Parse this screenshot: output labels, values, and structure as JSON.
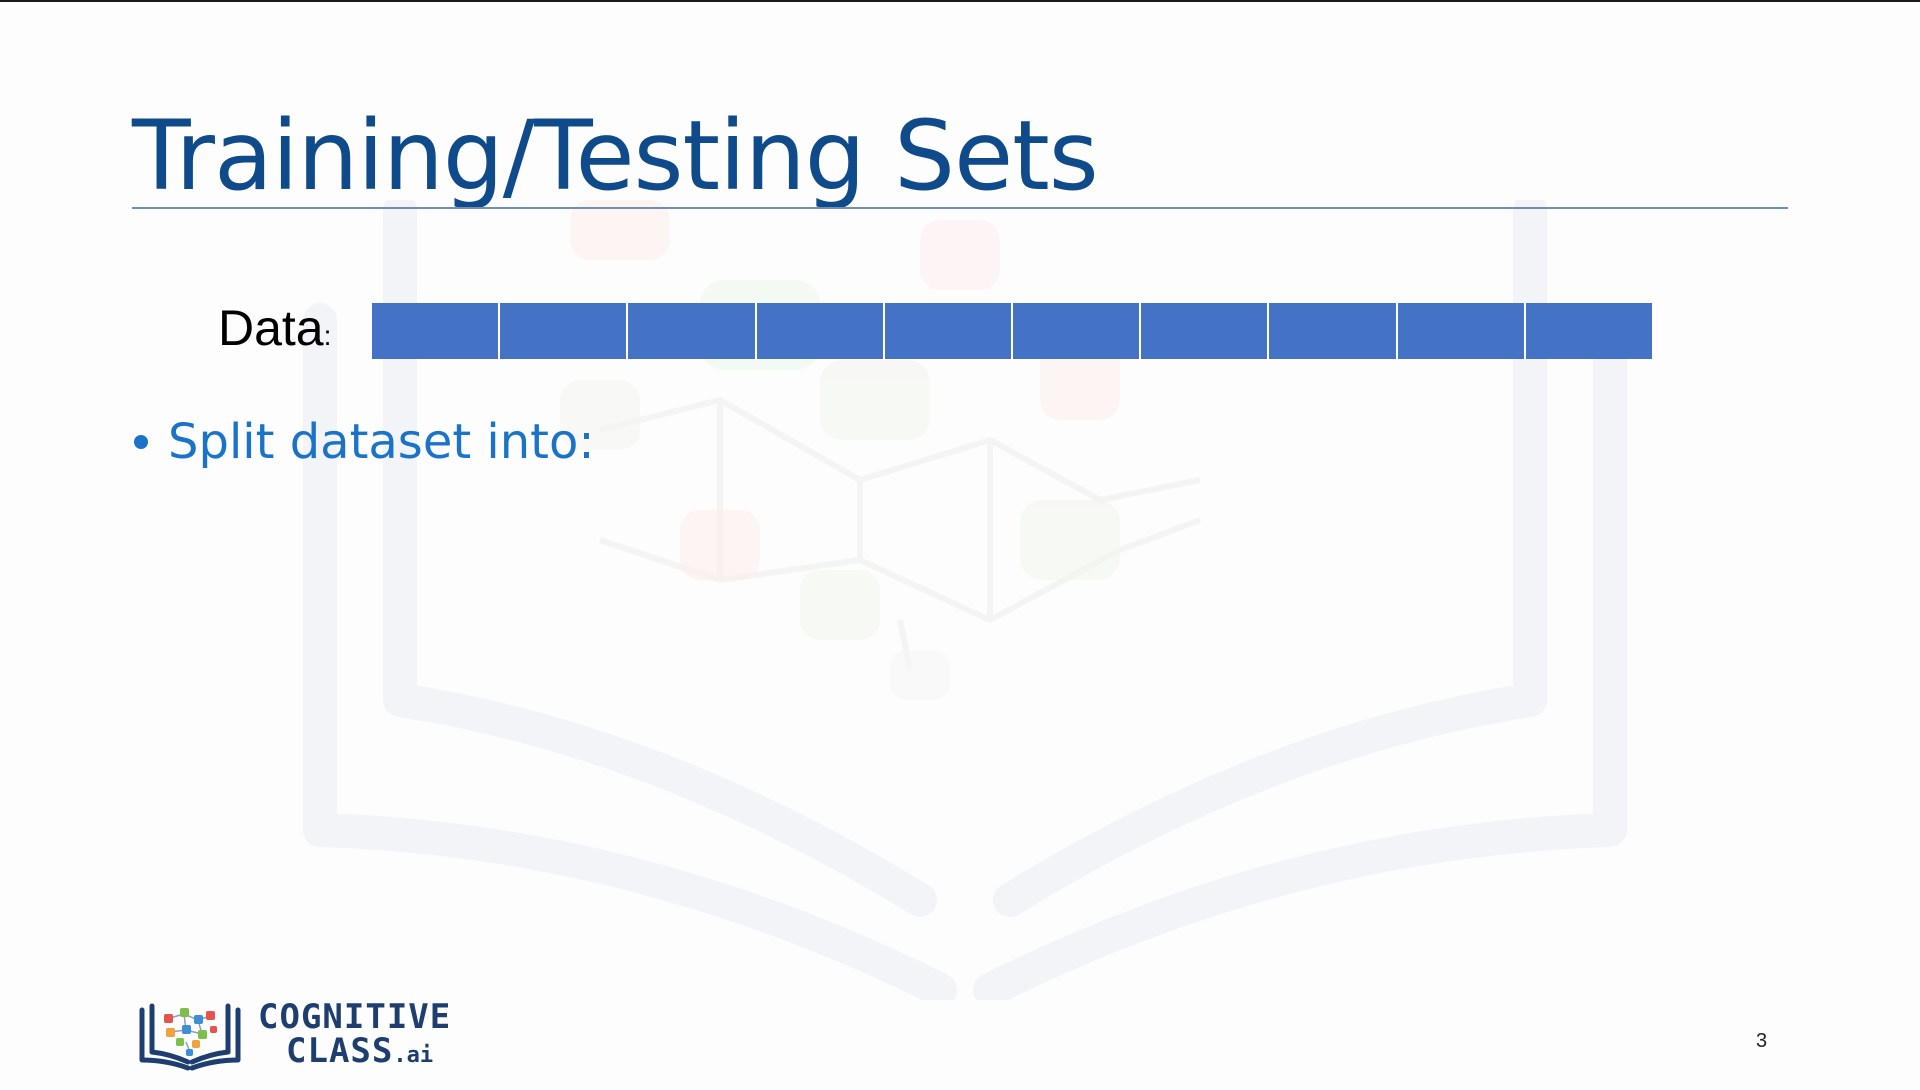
{
  "slide": {
    "title": "Training/Testing Sets",
    "data_label": "Data",
    "data_label_colon": ":",
    "data_bar": {
      "segment_count": 10,
      "color": "#4472c4"
    },
    "bullets": [
      "Split dataset into:"
    ],
    "page_number": "3"
  },
  "logo": {
    "line1": "COGNITIVE",
    "line2": "CLASS",
    "suffix": ".ai"
  },
  "colors": {
    "title": "#0f4a8a",
    "bullet": "#1a73c9",
    "rule": "#6f8fb4",
    "logo_text": "#1d3e6e"
  }
}
